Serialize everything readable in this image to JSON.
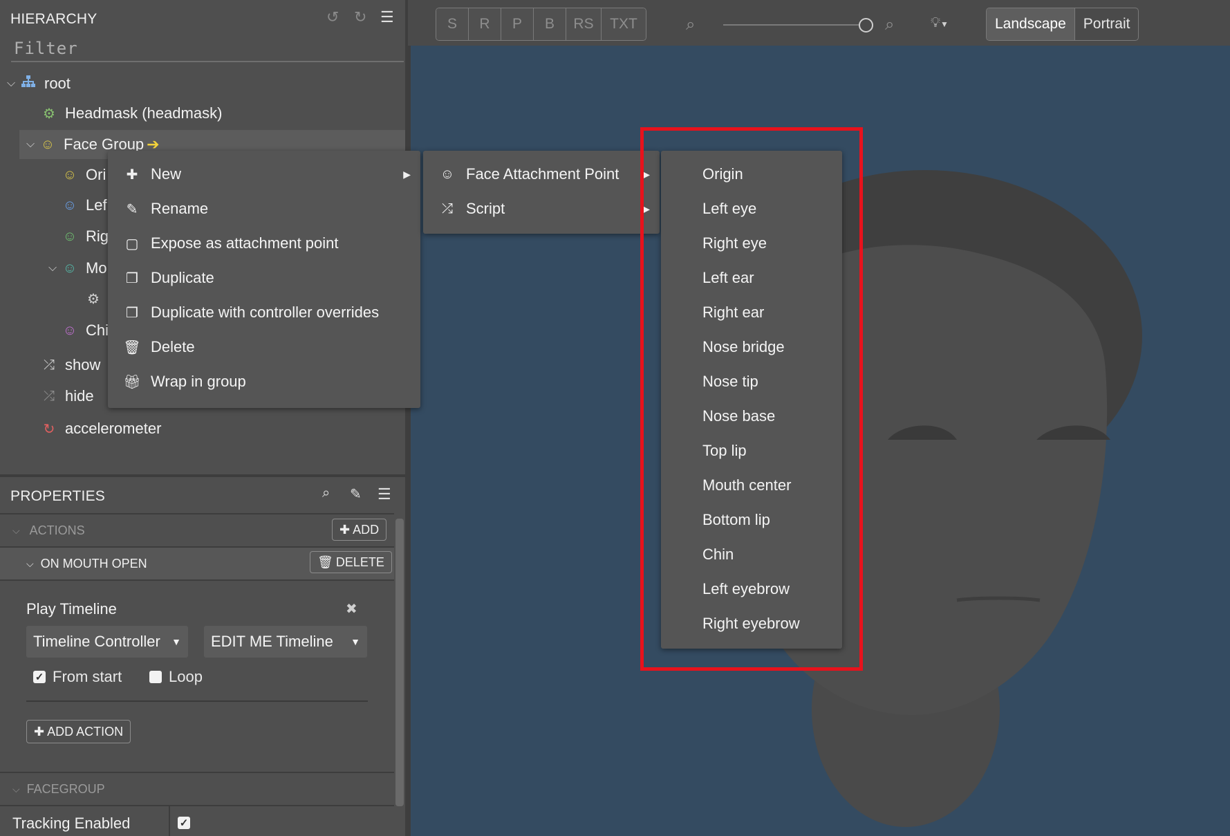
{
  "hierarchy": {
    "title": "HIERARCHY",
    "filter_placeholder": "Filter",
    "items": [
      {
        "label": "root"
      },
      {
        "label": "Headmask (headmask)"
      },
      {
        "label": "Face Group"
      },
      {
        "label": "Ori"
      },
      {
        "label": "Lef"
      },
      {
        "label": "Rig"
      },
      {
        "label": "Mo"
      },
      {
        "label": ""
      },
      {
        "label": "Chi"
      },
      {
        "label": "show"
      },
      {
        "label": "hide"
      },
      {
        "label": "accelerometer"
      }
    ]
  },
  "properties": {
    "title": "PROPERTIES",
    "actions_label": "ACTIONS",
    "add_label": "ADD",
    "on_mouth_open_label": "ON MOUTH OPEN",
    "delete_label": "DELETE",
    "play_timeline_label": "Play Timeline",
    "controller_select": "Timeline Controller",
    "timeline_select": "EDIT ME Timeline",
    "from_start_label": "From start",
    "loop_label": "Loop",
    "add_action_label": "ADD ACTION",
    "facegroup_label": "FACEGROUP",
    "tracking_enabled_label": "Tracking Enabled"
  },
  "toolbar": {
    "buttons": [
      "S",
      "R",
      "P",
      "B",
      "RS",
      "TXT"
    ],
    "landscape_label": "Landscape",
    "portrait_label": "Portrait",
    "zoom_fraction": 1.0
  },
  "context_menu": {
    "items": [
      {
        "label": "New",
        "icon": "plus-icon"
      },
      {
        "label": "Rename",
        "icon": "pencil-icon"
      },
      {
        "label": "Expose as attachment point",
        "icon": "square-icon"
      },
      {
        "label": "Duplicate",
        "icon": "copy-icon"
      },
      {
        "label": "Duplicate with controller overrides",
        "icon": "copy-icon"
      },
      {
        "label": "Delete",
        "icon": "trash-icon"
      },
      {
        "label": "Wrap in group",
        "icon": "gift-icon"
      }
    ]
  },
  "new_submenu": {
    "items": [
      {
        "label": "Face Attachment Point",
        "icon": "smiley-icon"
      },
      {
        "label": "Script",
        "icon": "shuffle-icon"
      }
    ]
  },
  "attachment_submenu": {
    "items": [
      "Origin",
      "Left eye",
      "Right eye",
      "Left ear",
      "Right ear",
      "Nose bridge",
      "Nose tip",
      "Nose base",
      "Top lip",
      "Mouth center",
      "Bottom lip",
      "Chin",
      "Left eyebrow",
      "Right eyebrow"
    ]
  },
  "colors": {
    "highlight": "#e8121c",
    "canvas": "#344b61",
    "panel": "#4f4f4f",
    "menu": "#555555"
  }
}
